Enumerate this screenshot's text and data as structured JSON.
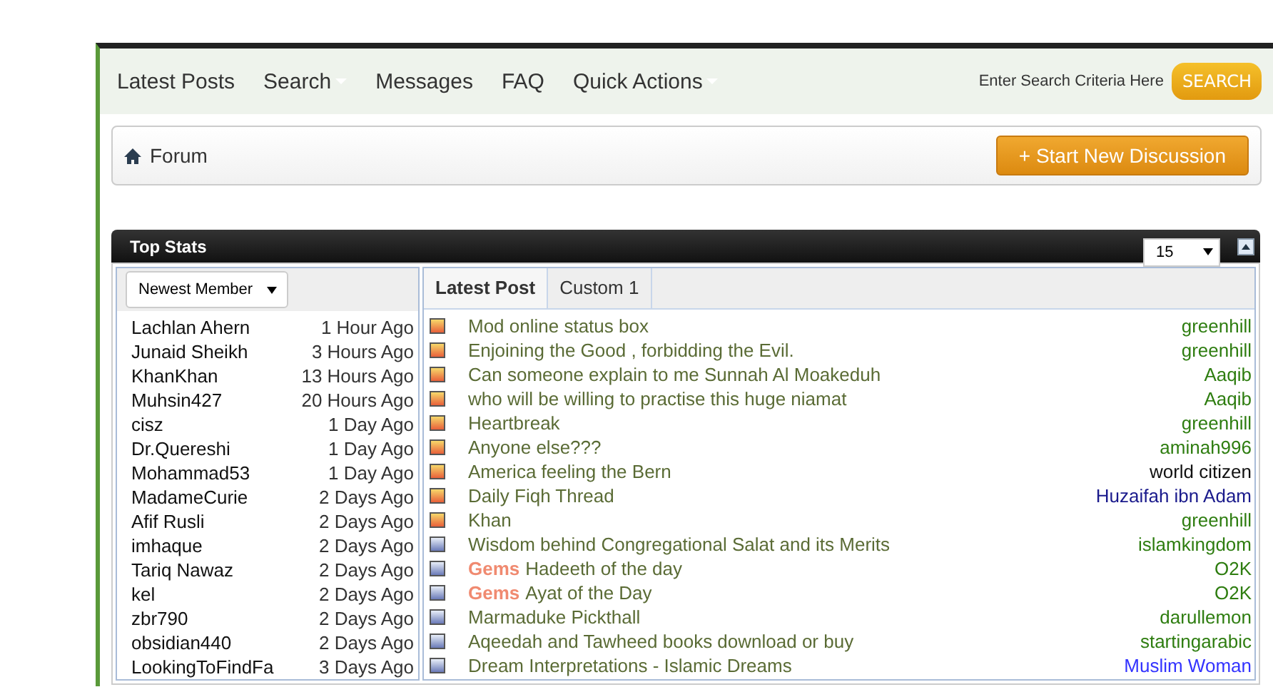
{
  "nav": {
    "items": [
      {
        "label": "Latest Posts",
        "dropdown": false
      },
      {
        "label": "Search",
        "dropdown": true
      },
      {
        "label": "Messages",
        "dropdown": false
      },
      {
        "label": "FAQ",
        "dropdown": false
      },
      {
        "label": "Quick Actions",
        "dropdown": true
      }
    ],
    "search_placeholder": "Enter Search Criteria Here",
    "search_button": "SEARCH"
  },
  "breadcrumb": {
    "label": "Forum",
    "button": "+ Start New Discussion"
  },
  "top_stats": {
    "title": "Top Stats",
    "count_select": "15",
    "members_select": "Newest Member",
    "members": [
      {
        "name": "Lachlan Ahern",
        "time": "1 Hour Ago"
      },
      {
        "name": "Junaid Sheikh",
        "time": "3 Hours Ago"
      },
      {
        "name": "KhanKhan",
        "time": "13 Hours Ago"
      },
      {
        "name": "Muhsin427",
        "time": "20 Hours Ago"
      },
      {
        "name": "cisz",
        "time": "1 Day Ago"
      },
      {
        "name": "Dr.Quereshi",
        "time": "1 Day Ago"
      },
      {
        "name": "Mohammad53",
        "time": "1 Day Ago"
      },
      {
        "name": "MadameCurie",
        "time": "2 Days Ago"
      },
      {
        "name": "Afif Rusli",
        "time": "2 Days Ago"
      },
      {
        "name": "imhaque",
        "time": "2 Days Ago"
      },
      {
        "name": "Tariq Nawaz",
        "time": "2 Days Ago"
      },
      {
        "name": "kel",
        "time": "2 Days Ago"
      },
      {
        "name": "zbr790",
        "time": "2 Days Ago"
      },
      {
        "name": "obsidian440",
        "time": "2 Days Ago"
      },
      {
        "name": "LookingToFindFa",
        "time": "3 Days Ago"
      }
    ],
    "tabs": [
      {
        "label": "Latest Post",
        "selected": true
      },
      {
        "label": "Custom 1",
        "selected": false
      }
    ],
    "posts": [
      {
        "title": "Mod online status box",
        "unread": true,
        "author": "greenhill",
        "color": "#2e7d10"
      },
      {
        "title": "Enjoining the Good , forbidding the Evil.",
        "unread": true,
        "author": "greenhill",
        "color": "#2e7d10"
      },
      {
        "title": "Can someone explain to me Sunnah Al Moakeduh",
        "unread": true,
        "author": "Aaqib",
        "color": "#2e7d10"
      },
      {
        "title": "who will be willing to practise this huge niamat",
        "unread": true,
        "author": "Aaqib",
        "color": "#2e7d10"
      },
      {
        "title": "Heartbreak",
        "unread": true,
        "author": "greenhill",
        "color": "#2e7d10"
      },
      {
        "title": "Anyone else???",
        "unread": true,
        "author": "aminah996",
        "color": "#2e7d10"
      },
      {
        "title": "America feeling the Bern",
        "unread": true,
        "author": "world citizen",
        "color": "#111111"
      },
      {
        "title": "Daily Fiqh Thread",
        "unread": true,
        "author": "Huzaifah ibn Adam",
        "color": "#1a1a8c"
      },
      {
        "title": "Khan",
        "unread": true,
        "author": "greenhill",
        "color": "#2e7d10"
      },
      {
        "title": "Wisdom behind Congregational Salat and its Merits",
        "unread": false,
        "author": "islamkingdom",
        "color": "#2e7d10"
      },
      {
        "prefix": "Gems",
        "title": "Hadeeth of the day",
        "unread": false,
        "author": "O2K",
        "color": "#2e7d10"
      },
      {
        "prefix": "Gems",
        "title": "Ayat of the Day",
        "unread": false,
        "author": "O2K",
        "color": "#2e7d10"
      },
      {
        "title": "Marmaduke Pickthall",
        "unread": false,
        "author": "darullemon",
        "color": "#2e7d10"
      },
      {
        "title": "Aqeedah and Tawheed books download or buy",
        "unread": false,
        "author": "startingarabic",
        "color": "#2e7d10"
      },
      {
        "title": "Dream Interpretations - Islamic Dreams",
        "unread": false,
        "author": "Muslim Woman",
        "color": "#3333ff"
      }
    ]
  }
}
